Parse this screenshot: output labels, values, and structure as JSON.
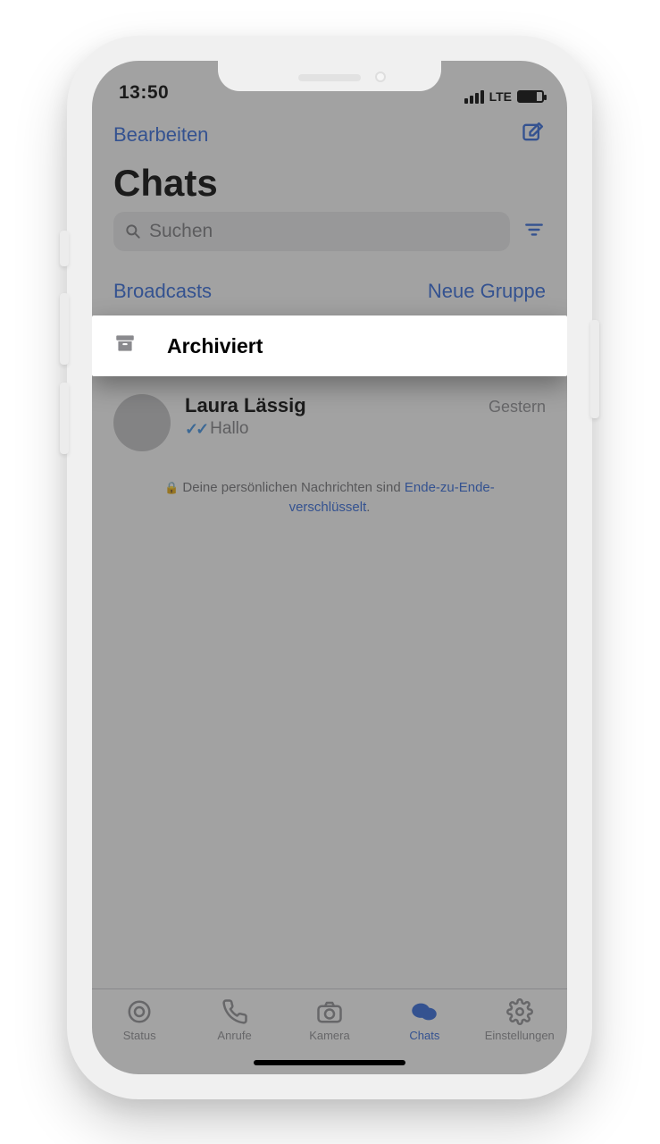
{
  "status": {
    "time": "13:50",
    "network": "LTE"
  },
  "nav": {
    "edit": "Bearbeiten"
  },
  "title": "Chats",
  "search": {
    "placeholder": "Suchen"
  },
  "links": {
    "broadcasts": "Broadcasts",
    "new_group": "Neue Gruppe"
  },
  "archived": {
    "label": "Archiviert"
  },
  "chat": {
    "name": "Laura Lässig",
    "time": "Gestern",
    "message": "Hallo"
  },
  "e2e": {
    "prefix": "Deine persönlichen Nachrichten sind ",
    "link": "Ende-zu-Ende-verschlüsselt",
    "suffix": "."
  },
  "tabs": {
    "status": "Status",
    "calls": "Anrufe",
    "camera": "Kamera",
    "chats": "Chats",
    "settings": "Einstellungen"
  }
}
